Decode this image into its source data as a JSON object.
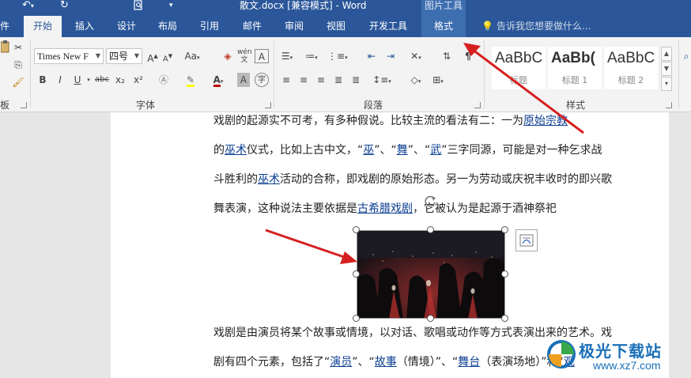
{
  "title_bar": {
    "doc_title": "散文.docx [兼容模式] - Word",
    "context_group": "图片工具",
    "undo_icon": "undo-icon",
    "redo_icon": "redo-icon",
    "print_preview_icon": "print-preview-icon",
    "customize_icon": "customize-quick-access-icon"
  },
  "tabs": {
    "file": "件",
    "home": "开始",
    "insert": "插入",
    "design": "设计",
    "layout": "布局",
    "references": "引用",
    "mailings": "邮件",
    "review": "审阅",
    "view": "视图",
    "developer": "开发工具",
    "format": "格式",
    "tell_me": "告诉我您想要做什么..."
  },
  "ribbon": {
    "clipboard_label": "板",
    "font_name": "Times New F",
    "font_size": "四号",
    "phonetic_label": "wén",
    "font_group_label": "字体",
    "paragraph_group_label": "段落",
    "styles_group_label": "样式",
    "styles": [
      {
        "sample": "AaBbC",
        "name": "标题"
      },
      {
        "sample": "AaBb(",
        "name": "标题 1"
      },
      {
        "sample": "AaBbC",
        "name": "标题 2"
      }
    ],
    "font_buttons": [
      "B",
      "I",
      "U",
      "abc",
      "x₂",
      "x²"
    ],
    "grow_font": "A",
    "shrink_font": "A",
    "change_case": "Aa",
    "font_color_accent": "#c00000",
    "highlight_accent": "#ffff00"
  },
  "document": {
    "line1_pre": "戏剧的起源实不可考，有多种假说。比较主流的看法有二：一为",
    "line1_link": "原始宗教",
    "line2_pre": "的",
    "line2_link1": "巫术",
    "line2_mid1": "仪式，比如上古中文，“",
    "line2_link2": "巫",
    "line2_mid2": "”、“",
    "line2_link3": "舞",
    "line2_mid3": "”、“",
    "line2_link4": "武",
    "line2_post": "”三字同源，可能是对一种乞求战",
    "line3_pre": "斗胜利的",
    "line3_link": "巫术",
    "line3_post": "活动的合称，即戏剧的原始形态。另一为劳动或庆祝丰收时的即兴歌",
    "line4_pre": "舞表演，这种说法主要依据是",
    "line4_link": "古希腊戏剧",
    "line4_post": "，它被认为是起源于酒神祭祀",
    "line5": "戏剧是由演员将某个故事或情境，以对话、歌唱或动作等方式表演出来的艺术。戏",
    "line6_pre": "剧有四个元素，包括了“",
    "line6_link1": "演员",
    "line6_mid1": "”、“",
    "line6_link2": "故事",
    "line6_mid2": "（情境）”、“",
    "line6_link3": "舞台",
    "line6_mid3": "（表演场地）”和“",
    "line6_link4": "观"
  },
  "watermark": {
    "main": "极光下载站",
    "url": "www.xz7.com"
  },
  "colors": {
    "word_blue": "#2b579a",
    "format_tab": "#3d6eb0",
    "annotation_arrow": "#d62020",
    "link": "#0b3d91"
  }
}
